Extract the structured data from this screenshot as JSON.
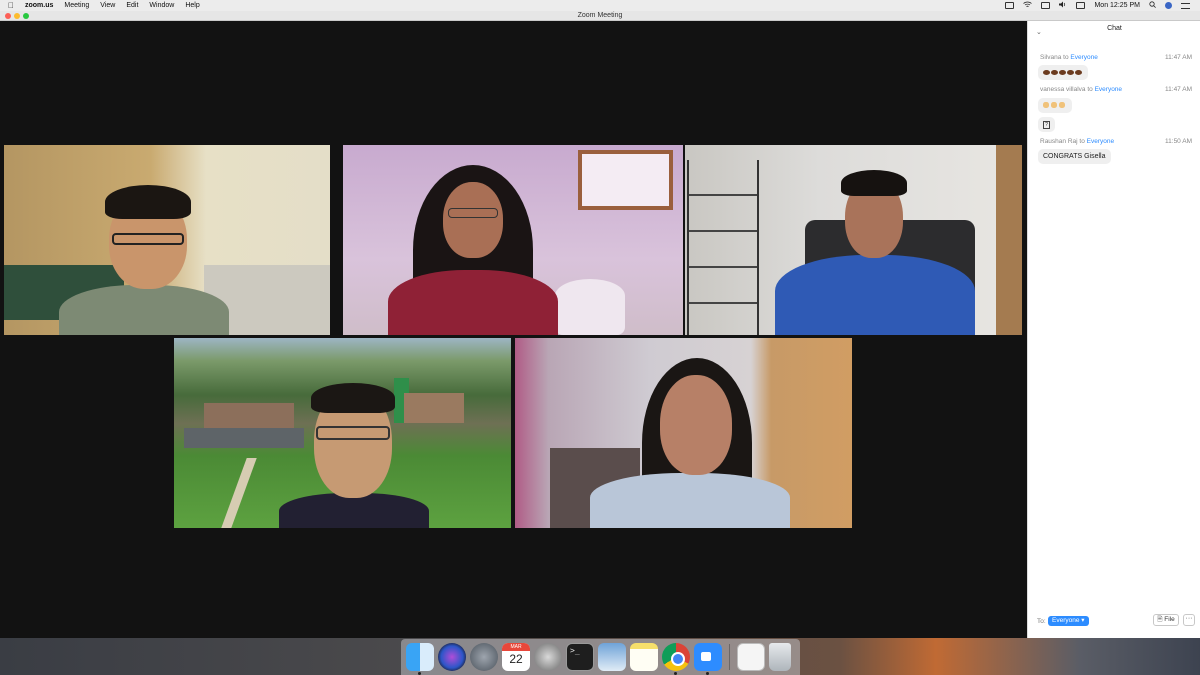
{
  "menubar": {
    "app_name": "zoom.us",
    "menus": [
      "Meeting",
      "View",
      "Edit",
      "Window",
      "Help"
    ],
    "clock": "Mon 12:25 PM"
  },
  "window": {
    "title": "Zoom Meeting"
  },
  "chat": {
    "title": "Chat",
    "messages": [
      {
        "sender": "Silvana",
        "to_word": "to",
        "recipient": "Everyone",
        "time": "11:47 AM",
        "content": "coffee-bean emoji x5"
      },
      {
        "sender": "vanessa villalva",
        "to_word": "to",
        "recipient": "Everyone",
        "time": "11:47 AM",
        "content": "clapping-hands emoji x3"
      },
      {
        "sender": "",
        "to_word": "",
        "recipient": "",
        "time": "",
        "content": "unknown-glyph"
      },
      {
        "sender": "Raushan Raj",
        "to_word": "to",
        "recipient": "Everyone",
        "time": "11:50 AM",
        "content": "CONGRATS Gisella"
      }
    ],
    "footer": {
      "to_label": "To:",
      "recipient": "Everyone",
      "file_label": "File",
      "more_label": "···"
    }
  },
  "dock": {
    "calendar_month": "MAR",
    "calendar_day": "22",
    "terminal_prompt": ">_",
    "items": [
      "finder",
      "siri",
      "launchpad",
      "calendar",
      "system-preferences",
      "terminal",
      "preview",
      "notes",
      "chrome",
      "zoom",
      "document",
      "trash"
    ]
  },
  "colors": {
    "zoom_blue": "#2d8cff",
    "active_speaker_outline": "#d8d652",
    "video_background": "#121212"
  }
}
